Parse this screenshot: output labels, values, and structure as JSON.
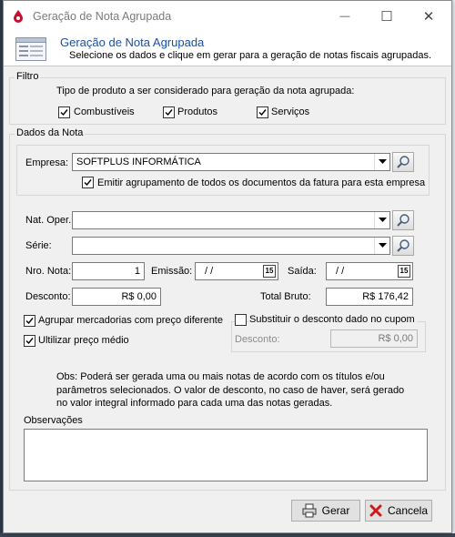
{
  "window": {
    "title": "Geração de Nota Agrupada",
    "minimize_icon": "—",
    "maximize_icon": "☐",
    "close_icon": "✕"
  },
  "header": {
    "title": "Geração de Nota Agrupada",
    "subtitle": "Selecione os dados e clique em gerar para a geração de notas fiscais agrupadas."
  },
  "filtro": {
    "legend": "Filtro",
    "prompt": "Tipo de produto a ser considerado para geração da nota agrupada:",
    "options": [
      {
        "label": "Combustíveis",
        "checked": true
      },
      {
        "label": "Produtos",
        "checked": true
      },
      {
        "label": "Serviços",
        "checked": true
      }
    ]
  },
  "dados": {
    "legend": "Dados da Nota",
    "empresa_label": "Empresa:",
    "empresa_value": "SOFTPLUS INFORMÁTICA",
    "emitir_label": "Emitir agrupamento de todos os documentos da fatura para esta empresa",
    "nat_oper_label": "Nat. Oper.",
    "nat_oper_value": "",
    "serie_label": "Série:",
    "serie_value": "",
    "nro_nota_label": "Nro. Nota:",
    "nro_nota_value": "1",
    "emissao_label": "Emissão:",
    "emissao_value": "/  /",
    "saida_label": "Saída:",
    "saida_value": "/  /",
    "cal_icon": "15",
    "desconto_label": "Desconto:",
    "desconto_value": "R$ 0,00",
    "total_bruto_label": "Total Bruto:",
    "total_bruto_value": "R$ 176,42",
    "agrupar_label": "Agrupar mercadorias com preço diferente",
    "agrupar_checked": true,
    "preco_medio_label": "Ultilizar preço médio",
    "preco_medio_checked": true,
    "substituir_label": "Substituir o desconto dado no cupom",
    "substituir_checked": false,
    "desc_cupom_label": "Desconto:",
    "desc_cupom_value": "R$ 0,00",
    "obs_text": "Obs: Poderá ser gerada uma ou mais notas de acordo com os títulos e/ou parâmetros selecionados. O valor de desconto, no caso de haver, será gerado no valor integral informado para cada uma das notas geradas.",
    "observacoes_label": "Observações",
    "observacoes_value": ""
  },
  "buttons": {
    "gerar": "Gerar",
    "cancelar": "Cancela"
  }
}
